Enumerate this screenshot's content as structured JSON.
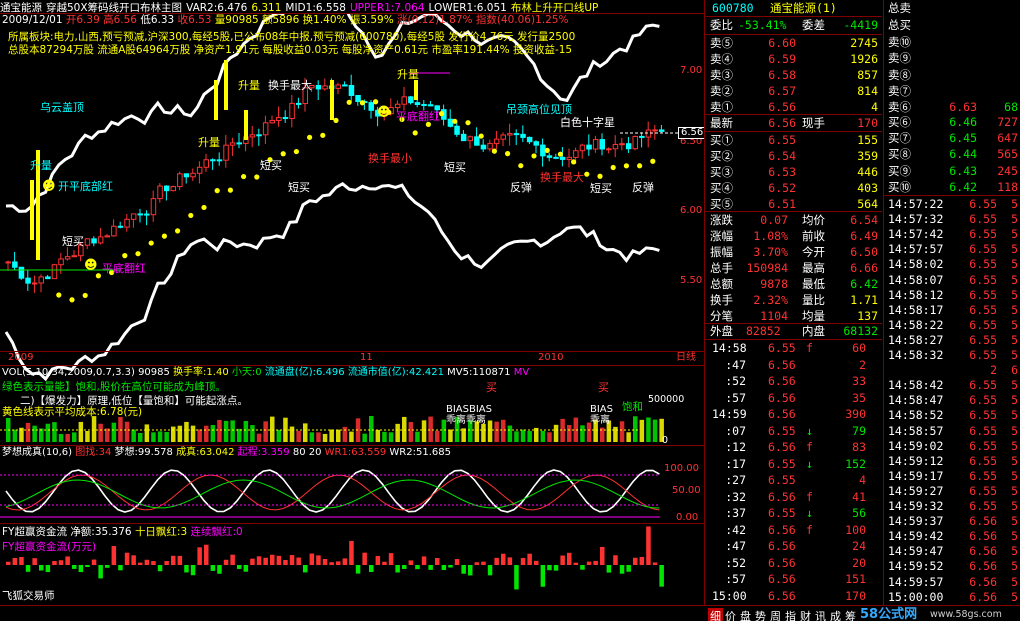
{
  "header": {
    "stock": "通宝能源",
    "indicator": "穿越50X筹码线开口布林主图",
    "var2": "VAR2:6.476",
    "var2b": "6.311",
    "mid1": "MID1:6.558",
    "upper1": "UPPER1:7.064",
    "lower1": "LOWER1:6.051",
    "boll_label": "布林上升开口线UP",
    "date": "2009/12/01",
    "open": "开6.39",
    "high": "高6.56",
    "low": "低6.33",
    "close": "收6.53",
    "volume": "量90985",
    "amount": "额5896",
    "turnover": "换1.40%",
    "amplitude": "振3.59%",
    "change": "涨(0.12)1.87%",
    "index_change": "指数(40.06)1.25%"
  },
  "info": {
    "line1": "所属板块:电力,山西,预亏预减,沪深300,每经5股,已公布08年中报,预亏预减(600780),每经5股",
    "line1b": "发行价4.76元",
    "line1c": "发行量2500",
    "line2": "总股本87294万股",
    "line2b": "流通A股64964万股",
    "line2c": "净资产1.91元",
    "line2d": "每股收益0.03元",
    "line2e": "每股净资产0.61元",
    "line2f": "市盈率191.44%",
    "line2g": "投资收益-15"
  },
  "chart_annotations": {
    "wuyun": "乌云盖顶",
    "diaojing": "吊颈高位见顶",
    "baiseshizi": "白色十字星",
    "huanshou_max1": "换手最大",
    "huanshou_max2": "换手最大",
    "shengliang": "升量",
    "kaiping": "开平底部红",
    "duanmai1": "短买",
    "duanmai2": "短买",
    "duanmai3": "短买",
    "duanmai4": "短买",
    "pinghu": "平底翻红",
    "fantan1": "反弹",
    "fantan2": "反弹",
    "xiaodi": "平底翻红",
    "shengliang2": "升量",
    "shengliang3": "升量",
    "huanshou_ji": "换手最小"
  },
  "y_axis": [
    "7.00",
    "6.50",
    "6.00",
    "5.50"
  ],
  "price_flag": "6.56",
  "x_axis": {
    "left": "2009",
    "mid": "11",
    "right": "2010",
    "tag": "日线"
  },
  "vol_panel": {
    "title": "VOL(5,10,34,2009,0.7,3.3)",
    "vol": "90985",
    "huanshou": "换手率:1.40",
    "xiaotian": "小天:0",
    "liutongpan": "流通盘(亿):6.496",
    "liutongshizhi": "流通市值(亿):42.421",
    "mv5": "MV5:110871",
    "mv": "MV",
    "note1": "绿色表示量能】饱和,股价在高位可能成为峰顶。",
    "note2": "二)【爆发力】原理,低位【量饱和】可能起涨点。",
    "note3": "黄色线表示平均成本:6.78(元)",
    "bias1": "BIASBIAS",
    "bias2": "乖离乖离",
    "bias3": "BIAS",
    "bias4": "乖离",
    "mai1": "买",
    "mai2": "买",
    "baohe": "饱和",
    "scale": "500000",
    "scale2": "0"
  },
  "kdj_panel": {
    "title": "梦想成真(10,6)",
    "tusheng": "图找:34",
    "mengxiang": "梦想:99.578",
    "chengzhen": "成真:63.042",
    "qichen": "起程:3.359",
    "v80": "80",
    "v20": "20",
    "wr1": "WR1:63.559",
    "wr2": "WR2:51.685",
    "ticks": [
      "100.00",
      "50.00",
      "0.00"
    ]
  },
  "fund_panel": {
    "title": "FY超赢资金流",
    "jingliu": "净额:35.376",
    "shiri": "十日飘红:3",
    "lianxu": "连续飘红:0",
    "line2": "FY超赢资金流(万元)",
    "author": "飞狐交易师"
  },
  "quote": {
    "code": "600780",
    "name": "通宝能源(1)",
    "weibi_label": "委比",
    "weibi": "-53.41%",
    "weicha_label": "委差",
    "weicha": "-4419",
    "sells": [
      {
        "label": "卖⑤",
        "price": "6.60",
        "vol": "2745"
      },
      {
        "label": "卖④",
        "price": "6.59",
        "vol": "1926"
      },
      {
        "label": "卖③",
        "price": "6.58",
        "vol": "857"
      },
      {
        "label": "卖②",
        "price": "6.57",
        "vol": "814"
      },
      {
        "label": "卖①",
        "price": "6.56",
        "vol": "4"
      }
    ],
    "latest_label": "最新",
    "latest": "6.56",
    "xianshou_label": "现手",
    "xianshou": "170",
    "buys": [
      {
        "label": "买①",
        "price": "6.55",
        "vol": "155"
      },
      {
        "label": "买②",
        "price": "6.54",
        "vol": "359"
      },
      {
        "label": "买③",
        "price": "6.53",
        "vol": "446"
      },
      {
        "label": "买④",
        "price": "6.52",
        "vol": "403"
      },
      {
        "label": "买⑤",
        "price": "6.51",
        "vol": "564"
      }
    ],
    "stats": [
      {
        "l1": "涨跌",
        "v1": "0.07",
        "l2": "均价",
        "v2": "6.54"
      },
      {
        "l1": "涨幅",
        "v1": "1.08%",
        "l2": "前收",
        "v2": "6.49"
      },
      {
        "l1": "振幅",
        "v1": "3.70%",
        "l2": "今开",
        "v2": "6.50"
      },
      {
        "l1": "总手",
        "v1": "150984",
        "l2": "最高",
        "v2": "6.66"
      },
      {
        "l1": "总额",
        "v1": "9878",
        "l2": "最低",
        "v2": "6.42"
      },
      {
        "l1": "换手",
        "v1": "2.32%",
        "l2": "量比",
        "v2": "1.71"
      },
      {
        "l1": "分笔",
        "v1": "1104",
        "l2": "均量",
        "v2": "137"
      }
    ],
    "waipan_label": "外盘",
    "waipan": "82852",
    "neipan_label": "内盘",
    "neipan": "68132",
    "ticks": [
      {
        "t": "14:58",
        "p": "6.55",
        "f": "f",
        "v": "60"
      },
      {
        "t": ":47",
        "p": "6.56",
        "f": "",
        "v": "2"
      },
      {
        "t": ":52",
        "p": "6.56",
        "f": "",
        "v": "33"
      },
      {
        "t": ":57",
        "p": "6.56",
        "f": "",
        "v": "35"
      },
      {
        "t": "14:59",
        "p": "6.56",
        "f": "",
        "v": "390"
      },
      {
        "t": ":07",
        "p": "6.55",
        "f": "↓",
        "v": "79"
      },
      {
        "t": ":12",
        "p": "6.56",
        "f": "f",
        "v": "83"
      },
      {
        "t": ":17",
        "p": "6.55",
        "f": "↓",
        "v": "152"
      },
      {
        "t": ":27",
        "p": "6.55",
        "f": "",
        "v": "4"
      },
      {
        "t": ":32",
        "p": "6.56",
        "f": "f",
        "v": "41"
      },
      {
        "t": ":37",
        "p": "6.55",
        "f": "↓",
        "v": "56"
      },
      {
        "t": ":42",
        "p": "6.56",
        "f": "f",
        "v": "100"
      },
      {
        "t": ":47",
        "p": "6.56",
        "f": "",
        "v": "24"
      },
      {
        "t": ":52",
        "p": "6.56",
        "f": "",
        "v": "20"
      },
      {
        "t": ":57",
        "p": "6.56",
        "f": "",
        "v": "151"
      },
      {
        "t": "15:00",
        "p": "6.56",
        "f": "",
        "v": "170"
      }
    ]
  },
  "queue": {
    "title": "总卖",
    "title2": "总买",
    "sells": [
      "卖⑩",
      "卖⑨",
      "卖⑧",
      "卖⑦",
      "卖⑥"
    ],
    "buys": [
      {
        "label": "买⑥",
        "price": "6.46",
        "vol": "727"
      },
      {
        "label": "买⑦",
        "price": "6.45",
        "vol": "647"
      },
      {
        "label": "买⑧",
        "price": "6.44",
        "vol": "565"
      },
      {
        "label": "买⑨",
        "price": "6.43",
        "vol": "245"
      },
      {
        "label": "买⑩",
        "price": "6.42",
        "vol": "118"
      }
    ],
    "sell6": {
      "label": "卖⑥",
      "price": "6.63",
      "vol": "68"
    },
    "rows": [
      {
        "t": "14:57:22",
        "p": "6.55",
        "v": "5"
      },
      {
        "t": "14:57:32",
        "p": "6.55",
        "v": "5"
      },
      {
        "t": "14:57:42",
        "p": "6.55",
        "v": "5"
      },
      {
        "t": "14:57:57",
        "p": "6.55",
        "v": "5"
      },
      {
        "t": "14:58:02",
        "p": "6.55",
        "v": "5"
      },
      {
        "t": "14:58:07",
        "p": "6.55",
        "v": "5"
      },
      {
        "t": "14:58:12",
        "p": "6.55",
        "v": "5"
      },
      {
        "t": "14:58:17",
        "p": "6.55",
        "v": "5"
      },
      {
        "t": "14:58:22",
        "p": "6.55",
        "v": "5"
      },
      {
        "t": "14:58:27",
        "p": "6.55",
        "v": "5"
      },
      {
        "t": "14:58:32",
        "p": "6.55",
        "v": "5"
      },
      {
        "t": "",
        "p": "2",
        "v": "6"
      },
      {
        "t": "14:58:42",
        "p": "6.55",
        "v": "5"
      },
      {
        "t": "14:58:47",
        "p": "6.55",
        "v": "5"
      },
      {
        "t": "14:58:52",
        "p": "6.55",
        "v": "5"
      },
      {
        "t": "14:58:57",
        "p": "6.55",
        "v": "5"
      },
      {
        "t": "14:59:02",
        "p": "6.55",
        "v": "5"
      },
      {
        "t": "14:59:12",
        "p": "6.55",
        "v": "5"
      },
      {
        "t": "14:59:17",
        "p": "6.55",
        "v": "5"
      },
      {
        "t": "14:59:27",
        "p": "6.55",
        "v": "5"
      },
      {
        "t": "14:59:32",
        "p": "6.55",
        "v": "5"
      },
      {
        "t": "14:59:37",
        "p": "6.56",
        "v": "5"
      },
      {
        "t": "14:59:42",
        "p": "6.56",
        "v": "5"
      },
      {
        "t": "14:59:47",
        "p": "6.56",
        "v": "5"
      },
      {
        "t": "14:59:52",
        "p": "6.56",
        "v": "5"
      },
      {
        "t": "14:59:57",
        "p": "6.56",
        "v": "5"
      },
      {
        "t": "15:00:00",
        "p": "6.56",
        "v": "5"
      }
    ]
  },
  "bottom_tabs": [
    "细",
    "价",
    "盘",
    "势",
    "周",
    "指",
    "财",
    "讯",
    "成",
    "筹"
  ],
  "watermark": "58公式网",
  "watermark_url": "www.58gs.com"
}
